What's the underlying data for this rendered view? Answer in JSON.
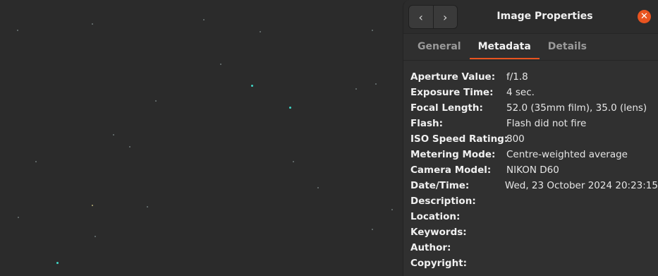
{
  "window": {
    "title": "Image Properties",
    "back_icon": "‹",
    "forward_icon": "›",
    "close_icon": "✕",
    "accent": "#e95420"
  },
  "tabs": [
    {
      "label": "General",
      "active": false
    },
    {
      "label": "Metadata",
      "active": true
    },
    {
      "label": "Details",
      "active": false
    }
  ],
  "metadata": [
    {
      "label": "Aperture Value:",
      "value": "f/1.8"
    },
    {
      "label": "Exposure Time:",
      "value": "4 sec."
    },
    {
      "label": "Focal Length:",
      "value": "52.0 (35mm film), 35.0 (lens)"
    },
    {
      "label": "Flash:",
      "value": "Flash did not fire"
    },
    {
      "label": "ISO Speed Rating:",
      "value": "800"
    },
    {
      "label": "Metering Mode:",
      "value": "Centre-weighted average"
    },
    {
      "label": "Camera Model:",
      "value": "NIKON D60"
    },
    {
      "label": "Date/Time:",
      "value": "Wed, 23 October 2024  20:23:15"
    },
    {
      "label": "Description:",
      "value": ""
    },
    {
      "label": "Location:",
      "value": ""
    },
    {
      "label": "Keywords:",
      "value": ""
    },
    {
      "label": "Author:",
      "value": ""
    },
    {
      "label": "Copyright:",
      "value": ""
    }
  ]
}
